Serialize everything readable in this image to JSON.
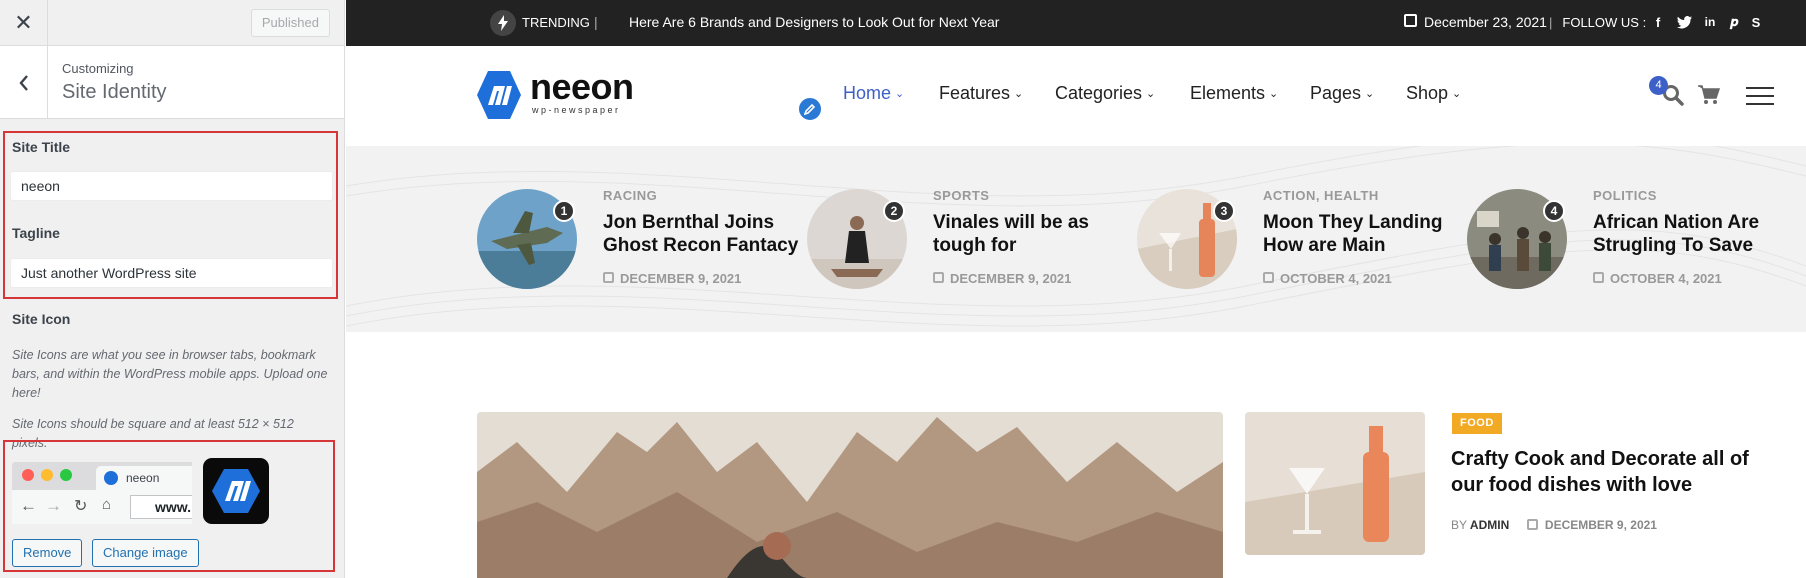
{
  "customizer": {
    "close_icon": "close-icon",
    "published_label": "Published",
    "customizing_label": "Customizing",
    "section_title": "Site Identity",
    "site_title_label": "Site Title",
    "site_title_value": "neeon",
    "tagline_label": "Tagline",
    "tagline_value": "Just another WordPress site",
    "site_icon_label": "Site Icon",
    "site_icon_desc1": "Site Icons are what you see in browser tabs, bookmark bars, and within the WordPress mobile apps. Upload one here!",
    "site_icon_desc2": "Site Icons should be square and at least 512 × 512 pixels.",
    "preview_tab_title": "neeon",
    "preview_url": "www.",
    "remove_label": "Remove",
    "change_image_label": "Change image",
    "highlight_color": "#d63638",
    "accent_color": "#2271b1"
  },
  "site": {
    "topbar": {
      "trending_label": "TRENDING",
      "separator": "|",
      "trending_text": "Here Are 6 Brands and Designers to Look Out for Next Year",
      "date": "December 23, 2021",
      "follow_label": "FOLLOW US :",
      "social_icons": [
        "facebook-icon",
        "twitter-icon",
        "linkedin-icon",
        "pinterest-icon",
        "skype-icon"
      ]
    },
    "logo": {
      "name": "neeon",
      "subtitle": "wp-newspaper"
    },
    "nav": [
      "Home",
      "Features",
      "Categories",
      "Elements",
      "Pages",
      "Shop"
    ],
    "cart_count": "4",
    "brand_color": "#3d5fc8",
    "trending_cards": [
      {
        "num": "1",
        "category": "RACING",
        "title": "Jon Bernthal Joins Ghost Recon Fantacy",
        "date": "DECEMBER 9, 2021"
      },
      {
        "num": "2",
        "category": "SPORTS",
        "title": "Vinales will be as tough for",
        "date": "DECEMBER 9, 2021"
      },
      {
        "num": "3",
        "category": "ACTION, HEALTH",
        "title": "Moon They Landing How are Main",
        "date": "OCTOBER 4, 2021"
      },
      {
        "num": "4",
        "category": "POLITICS",
        "title": "African Nation Are Strugling To Save",
        "date": "OCTOBER 4, 2021"
      }
    ],
    "side_post": {
      "badge": "FOOD",
      "badge_color": "#f2a923",
      "title": "Crafty Cook and Decorate all of our food dishes with love",
      "by_label": "BY",
      "author": "ADMIN",
      "date": "DECEMBER 9, 2021"
    }
  }
}
